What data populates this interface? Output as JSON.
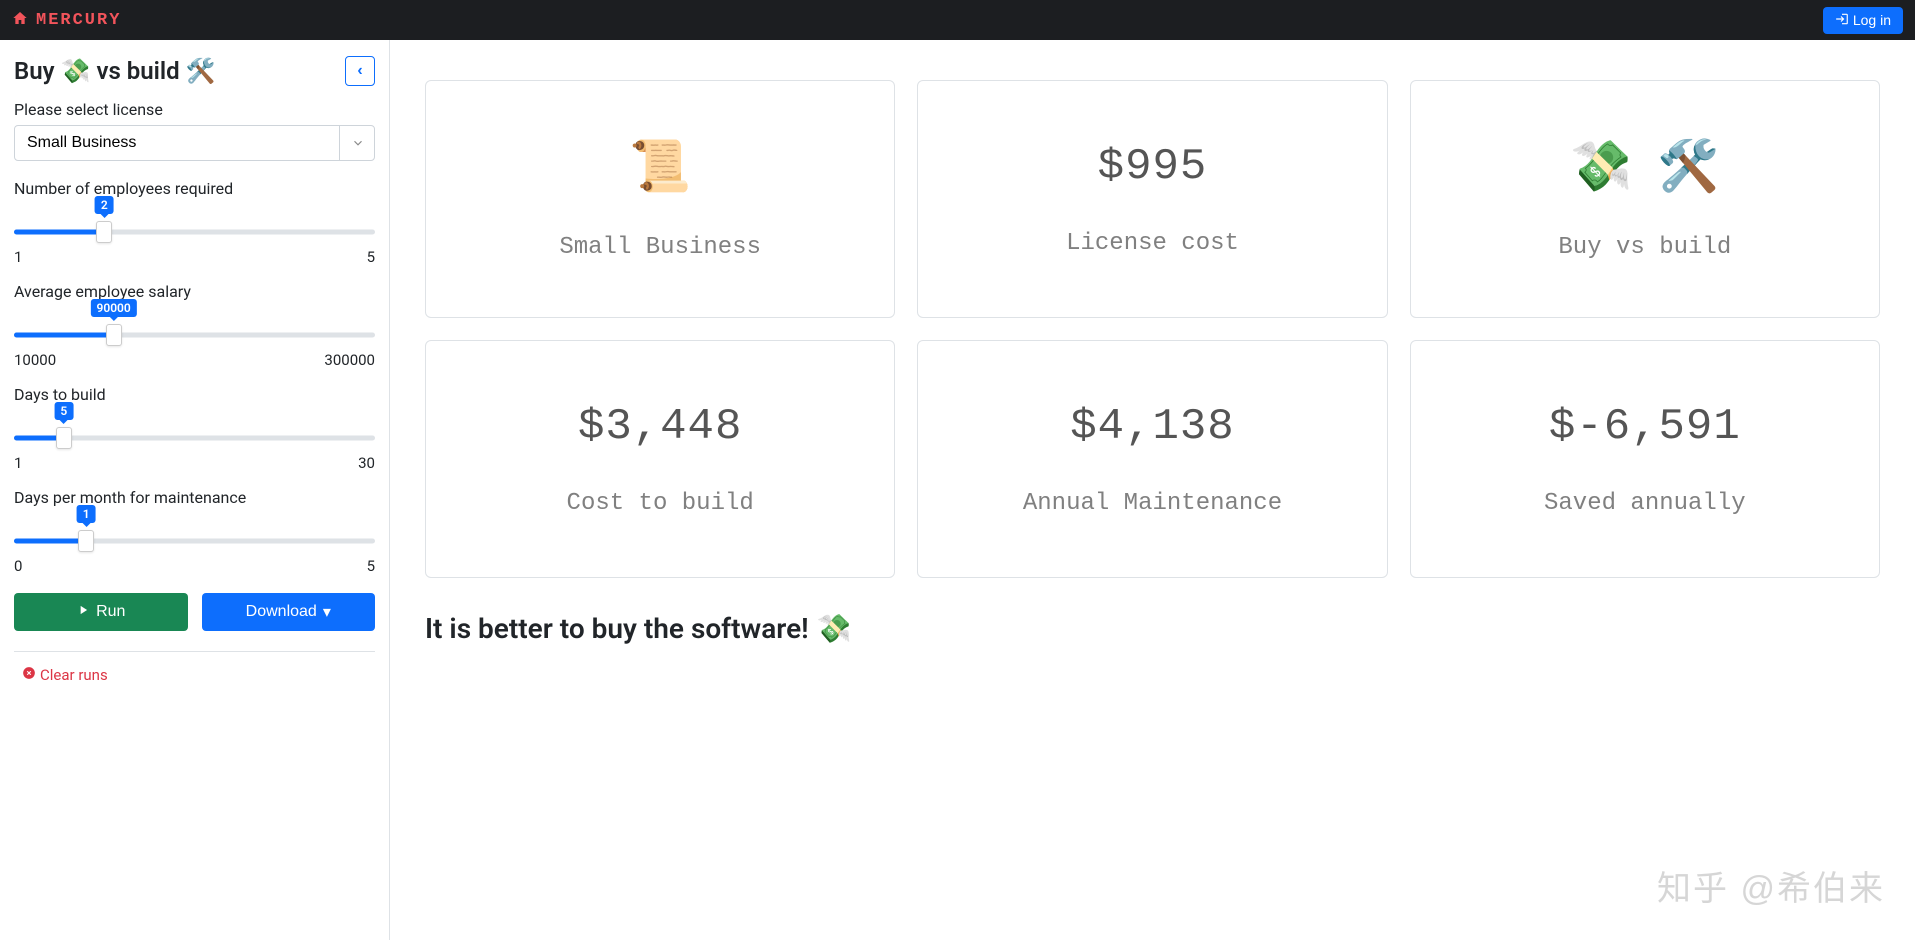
{
  "nav": {
    "brand": "MERCURY",
    "login": "Log in"
  },
  "sidebar": {
    "title_prefix": "Buy",
    "title_mid": "vs build",
    "license_label": "Please select license",
    "license_value": "Small Business",
    "sliders": {
      "employees": {
        "label": "Number of employees required",
        "value": "2",
        "min": "1",
        "max": "5",
        "pct": 25
      },
      "salary": {
        "label": "Average employee salary",
        "value": "90000",
        "min": "10000",
        "max": "300000",
        "pct": 27.6
      },
      "days_build": {
        "label": "Days to build",
        "value": "5",
        "min": "1",
        "max": "30",
        "pct": 13.8
      },
      "days_maint": {
        "label": "Days per month for maintenance",
        "value": "1",
        "min": "0",
        "max": "5",
        "pct": 20
      }
    },
    "run": "Run",
    "download": "Download",
    "clear_runs": "Clear runs"
  },
  "cards": {
    "tier_label": "Small Business",
    "license_cost_value": "$995",
    "license_cost_label": "License cost",
    "buy_vs_build_label": "Buy vs build",
    "cost_build_value": "$3,448",
    "cost_build_label": "Cost to build",
    "annual_maint_value": "$4,138",
    "annual_maint_label": "Annual Maintenance",
    "saved_value": "$-6,591",
    "saved_label": "Saved annually"
  },
  "conclusion": "It is better to buy the software!",
  "watermark": "知乎 @希伯来"
}
